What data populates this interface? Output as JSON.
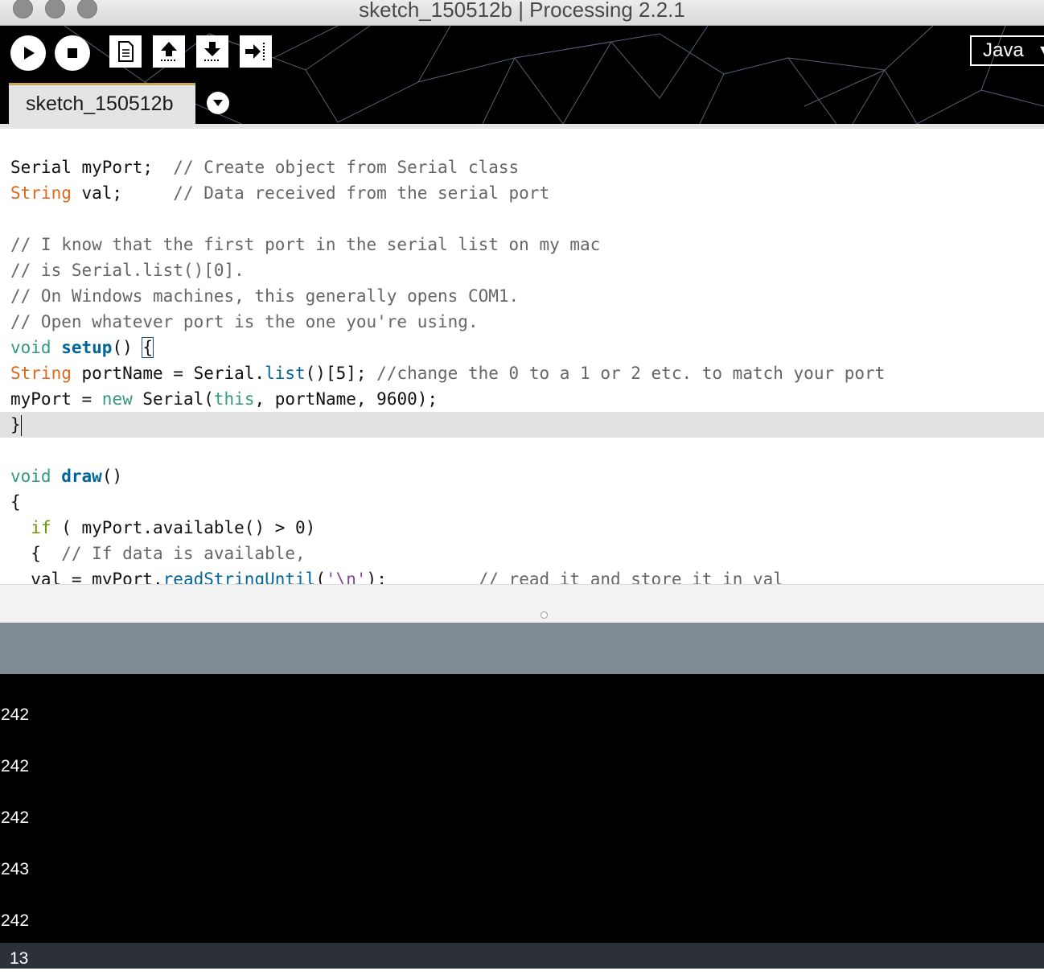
{
  "window": {
    "title": "sketch_150512b | Processing 2.2.1"
  },
  "toolbar": {
    "buttons": [
      {
        "name": "run",
        "icon": "play-icon"
      },
      {
        "name": "stop",
        "icon": "stop-icon"
      },
      {
        "name": "new",
        "icon": "new-file-icon"
      },
      {
        "name": "open",
        "icon": "open-up-arrow-icon"
      },
      {
        "name": "save",
        "icon": "save-down-arrow-icon"
      },
      {
        "name": "export",
        "icon": "export-arrow-icon"
      }
    ],
    "mode_label": "Java"
  },
  "tabs": [
    {
      "label": "sketch_150512b",
      "active": true
    }
  ],
  "editor": {
    "lines": [
      "",
      "Serial myPort;  // Create object from Serial class",
      "String val;     // Data received from the serial port",
      "",
      "// I know that the first port in the serial list on my mac",
      "// is Serial.list()[0].",
      "// On Windows machines, this generally opens COM1.",
      "// Open whatever port is the one you're using.",
      "void setup() {",
      "String portName = Serial.list()[5]; //change the 0 to a 1 or 2 etc. to match your port",
      "myPort = new Serial(this, portName, 9600);",
      "}",
      "",
      "void draw()",
      "{",
      "  if ( myPort.available() > 0)",
      "  {  // If data is available,",
      "  val = myPort.readStringUntil('\\n');         // read it and store it in val"
    ],
    "current_line": 11
  },
  "console": {
    "lines": [
      "242",
      "242",
      "242",
      "243",
      "242"
    ]
  },
  "footer": {
    "line_number": "13"
  },
  "colors": {
    "type_keyword": "#e2661a",
    "function_keyword": "#006699",
    "literal_keyword": "#33997e",
    "control_keyword": "#669900",
    "comment": "#666666",
    "console_bg": "#000000",
    "status_bar": "#818b95",
    "footer_bg": "#2c3039"
  }
}
